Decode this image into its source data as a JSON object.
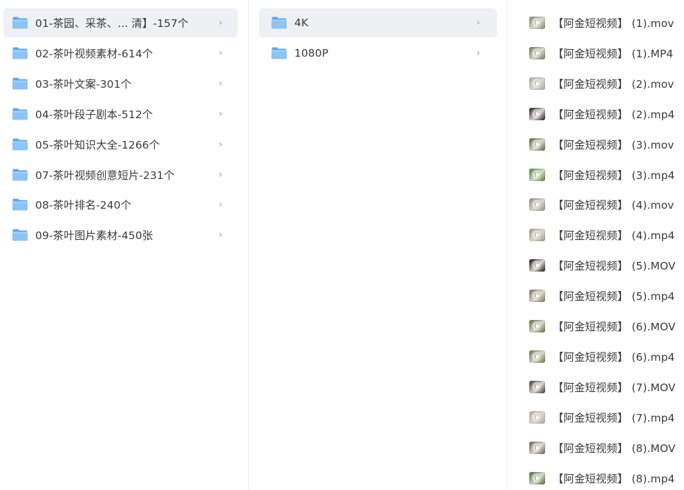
{
  "column1": {
    "items": [
      {
        "label": "01-茶园、采茶、...  清】-157个",
        "selected": true
      },
      {
        "label": "02-茶叶视频素材-614个",
        "selected": false
      },
      {
        "label": "03-茶叶文案-301个",
        "selected": false
      },
      {
        "label": "04-茶叶段子剧本-512个",
        "selected": false
      },
      {
        "label": "05-茶叶知识大全-1266个",
        "selected": false
      },
      {
        "label": "07-茶叶视频创意短片-231个",
        "selected": false
      },
      {
        "label": "08-茶叶排名-240个",
        "selected": false
      },
      {
        "label": "09-茶叶图片素材-450张",
        "selected": false
      }
    ]
  },
  "column2": {
    "items": [
      {
        "label": "4K",
        "selected": true
      },
      {
        "label": "1080P",
        "selected": false
      }
    ]
  },
  "column3": {
    "items": [
      {
        "label": "【阿金短视频】 (1).mov",
        "thumb": "#7a8f6a"
      },
      {
        "label": "【阿金短视频】 (1).MP4",
        "thumb": "#6e7b55"
      },
      {
        "label": "【阿金短视频】 (2).mov",
        "thumb": "#9fb1a3"
      },
      {
        "label": "【阿金短视频】 (2).mp4",
        "thumb": "#1c1c1c"
      },
      {
        "label": "【阿金短视频】 (3).mov",
        "thumb": "#4f6b3a"
      },
      {
        "label": "【阿金短视频】 (3).mp4",
        "thumb": "#3f8a2e"
      },
      {
        "label": "【阿金短视频】 (4).mov",
        "thumb": "#8a8f7d"
      },
      {
        "label": "【阿金短视频】 (4).mp4",
        "thumb": "#a09a8c"
      },
      {
        "label": "【阿金短视频】 (5).MOV",
        "thumb": "#111111"
      },
      {
        "label": "【阿金短视频】 (5).mp4",
        "thumb": "#7e7458"
      },
      {
        "label": "【阿金短视频】 (6).MOV",
        "thumb": "#5d6b3b"
      },
      {
        "label": "【阿金短视频】 (6).mp4",
        "thumb": "#5f7d42"
      },
      {
        "label": "【阿金短视频】 (7).MOV",
        "thumb": "#3d3a33"
      },
      {
        "label": "【阿金短视频】 (7).mp4",
        "thumb": "#b7a996"
      },
      {
        "label": "【阿金短视频】 (8).MOV",
        "thumb": "#6a5f55"
      },
      {
        "label": "【阿金短视频】 (8).mp4",
        "thumb": "#3f6e2f"
      }
    ]
  },
  "icons": {
    "folder": "folder-icon",
    "chevron": "chevron-right-icon",
    "video_thumbnail": "video-thumbnail-icon",
    "chevron_glyph": "›"
  },
  "colors": {
    "selected_row": "#eef0f3",
    "folder_front": "#8cc4f5",
    "folder_back": "#5fa8ef",
    "chevron": "#a3a8ae",
    "text": "#3a3a3a"
  }
}
